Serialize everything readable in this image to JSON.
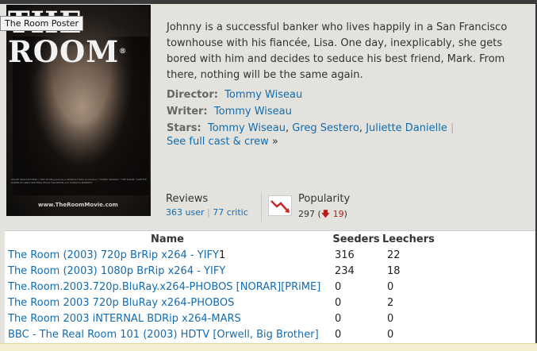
{
  "poster": {
    "title": "THE ROOM",
    "tm": "®",
    "tooltip": "The Room Poster",
    "credits": "CHLOE PRODUCTIONS / TPW FILMS presents a WISEAU-FILMS production \"TOMMY WISEAU\" \"THE ROOM\" JULIETTE DANIELLE GREG SESTERO PHILIP HALDIMAN and CAROLYN MINNOTT",
    "url": "www.TheRoomMovie.com"
  },
  "description": "Johnny is a successful banker who lives happily in a San Francisco townhouse with his fiancée, Lisa. One day, inexplicably, she gets bored with him and decides to seduce his best friend, Mark. From there, nothing will be the same again.",
  "director": {
    "label": "Director:",
    "name": "Tommy Wiseau"
  },
  "writer": {
    "label": "Writer:",
    "name": "Tommy Wiseau"
  },
  "stars": {
    "label": "Stars:",
    "names": [
      "Tommy Wiseau",
      "Greg Sestero",
      "Juliette Danielle"
    ],
    "comma": ",",
    "bar": "|",
    "full_cast": "See full cast & crew",
    "arrow": "»"
  },
  "reviews": {
    "label": "Reviews",
    "user": "363 user",
    "critic": "77 critic",
    "bar": "|"
  },
  "popularity": {
    "label": "Popularity",
    "rank": "297",
    "open": "(",
    "change": "19",
    "close": ")",
    "arrow": "🡇"
  },
  "table": {
    "headers": {
      "name": "Name",
      "seeders": "Seeders",
      "leechers": "Leechers"
    },
    "rows": [
      {
        "name": "The Room (2003) 720p BrRip x264 - YIFY",
        "suffix": "1",
        "seeders": "316",
        "leechers": "22"
      },
      {
        "name": "The Room (2003) 1080p BrRip x264 - YIFY",
        "suffix": "",
        "seeders": "234",
        "leechers": "18"
      },
      {
        "name": "The.Room.2003.720p.BluRay.x264-PHOBOS [NORAR][PRiME]",
        "suffix": "",
        "seeders": "0",
        "leechers": "0"
      },
      {
        "name": "The Room 2003 720p BluRay x264-PHOBOS",
        "suffix": "",
        "seeders": "0",
        "leechers": "2"
      },
      {
        "name": "The Room 2003 iNTERNAL BDRip x264-MARS",
        "suffix": "",
        "seeders": "0",
        "leechers": "0"
      },
      {
        "name": "BBC - The Real Room 101 (2003) HDTV [Orwell, Big Brother]",
        "suffix": "",
        "seeders": "0",
        "leechers": "0"
      }
    ]
  }
}
